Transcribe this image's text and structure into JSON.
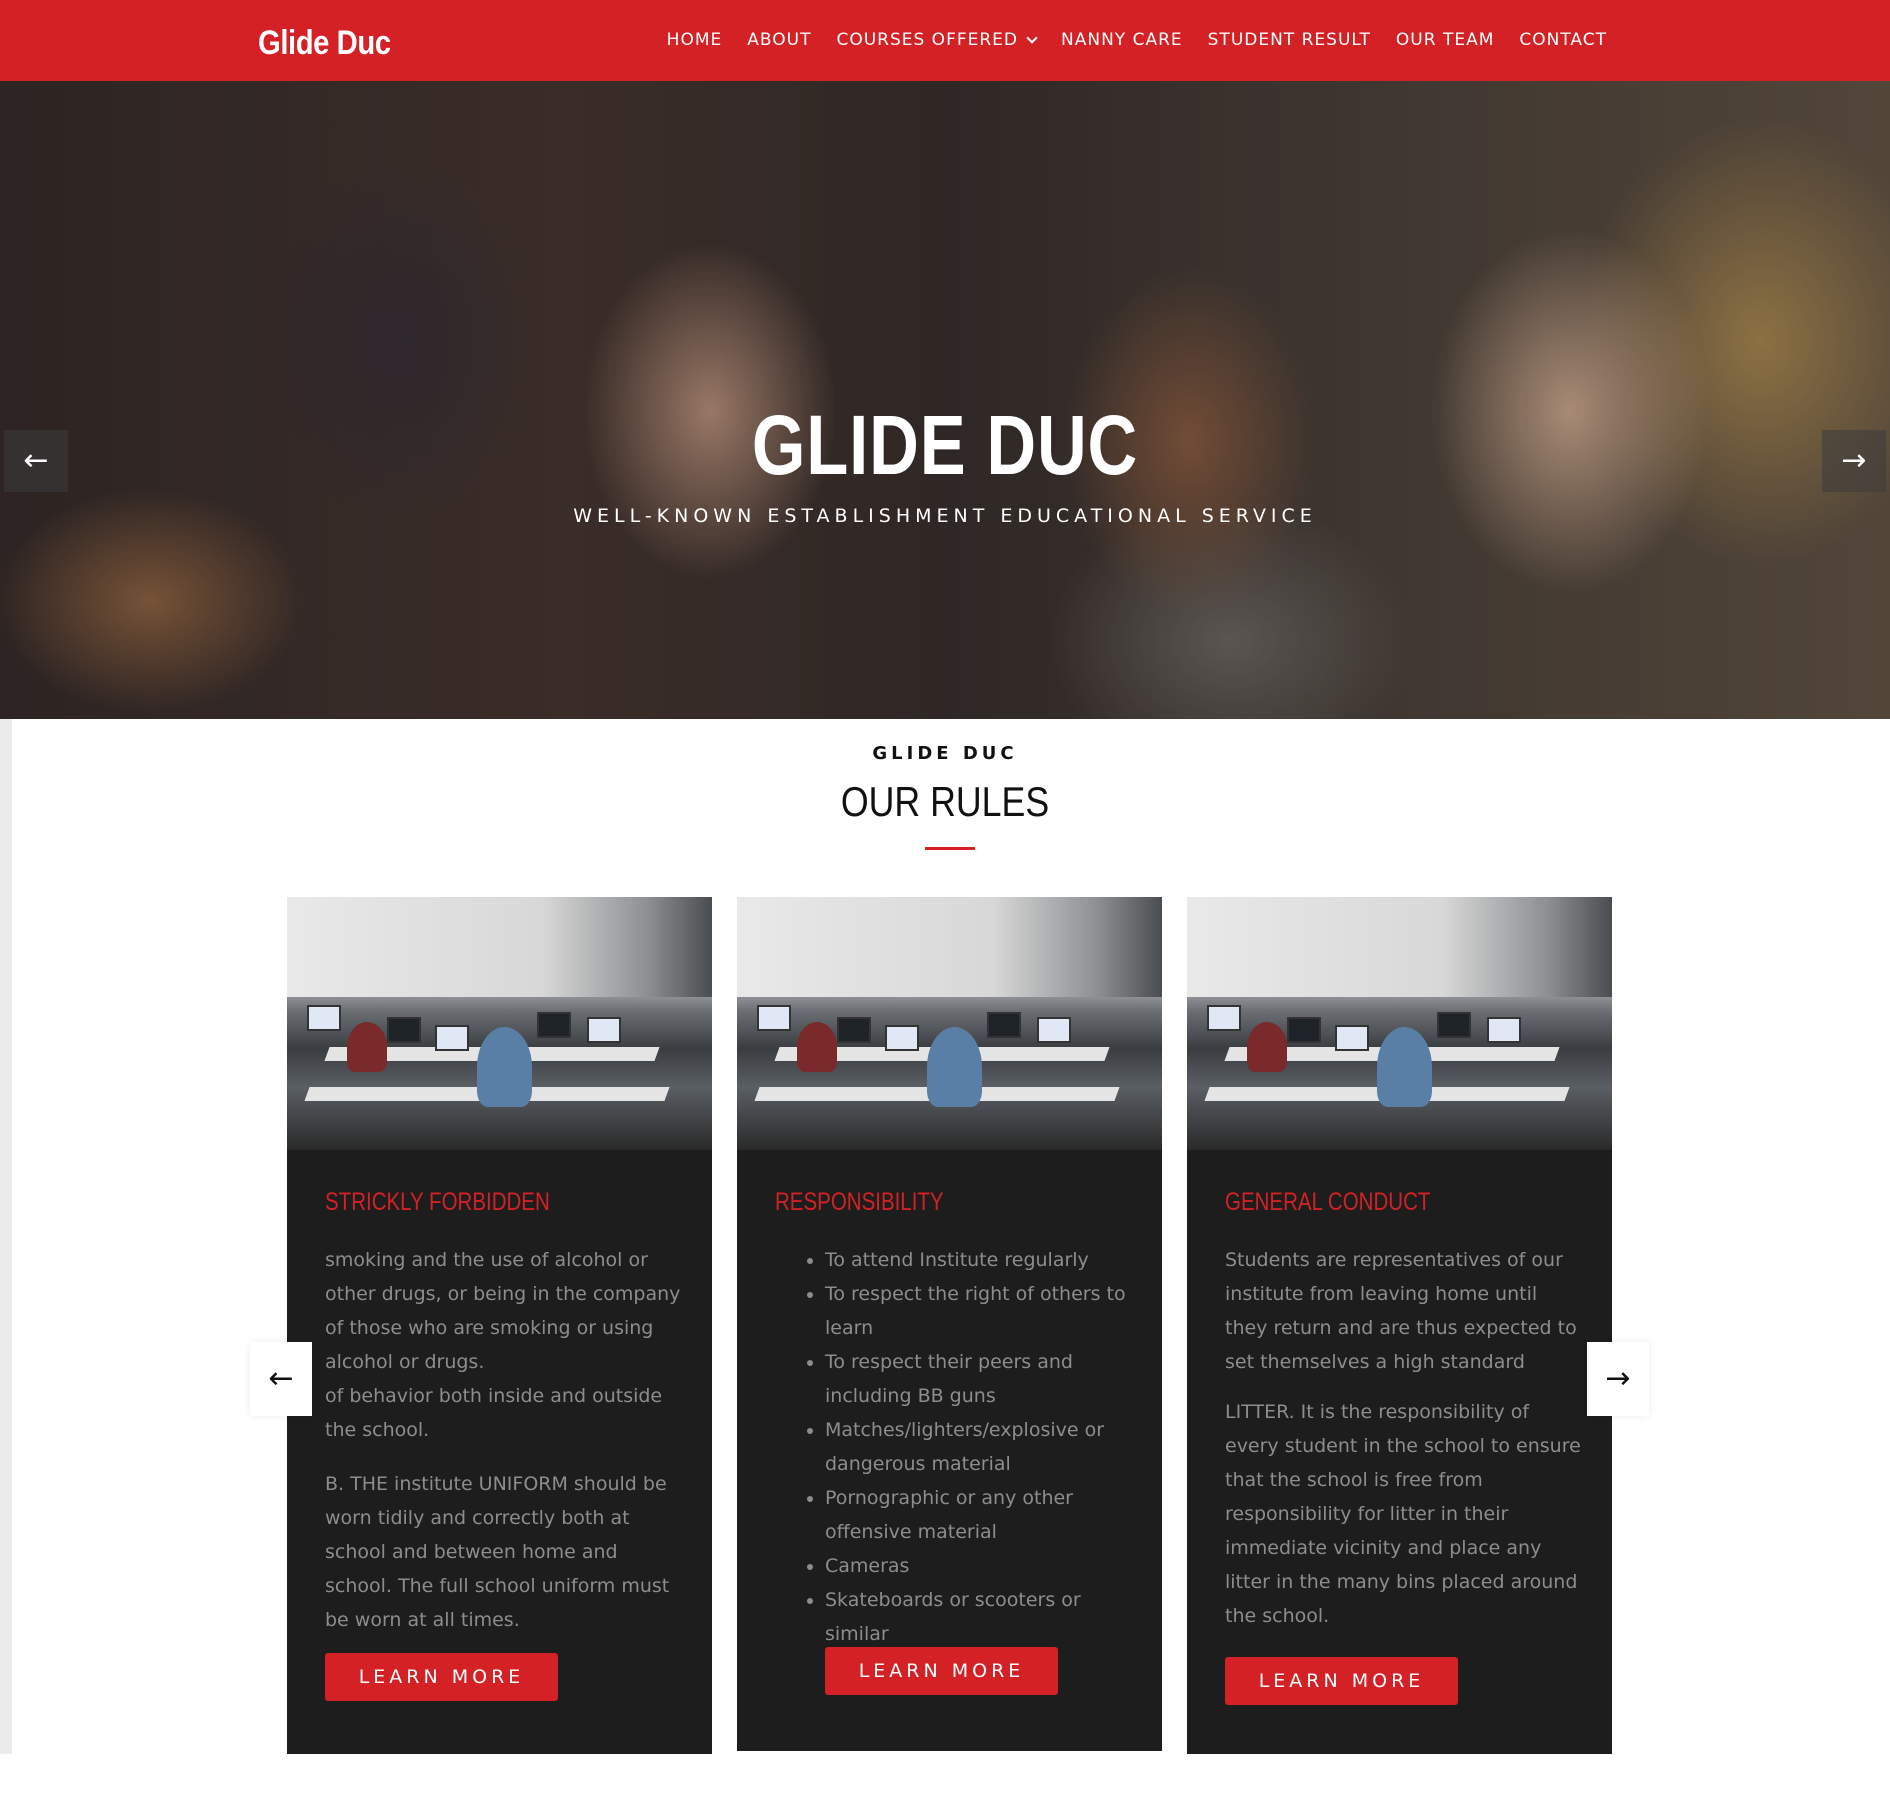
{
  "nav": {
    "brand": "Glide Duc",
    "items": [
      {
        "label": "HOME"
      },
      {
        "label": "ABOUT"
      },
      {
        "label": "COURSES OFFERED"
      },
      {
        "label": "NANNY CARE"
      },
      {
        "label": "STUDENT RESULT"
      },
      {
        "label": "OUR TEAM"
      },
      {
        "label": "CONTACT"
      }
    ]
  },
  "hero": {
    "title": "GLIDE DUC",
    "subtitle": "WELL-KNOWN ESTABLISHMENT EDUCATIONAL SERVICE",
    "prev_icon": "←",
    "next_icon": "→"
  },
  "section": {
    "eyebrow": "GLIDE DUC",
    "title": "OUR RULES"
  },
  "cards": [
    {
      "heading": "STRICKLY FORBIDDEN",
      "paragraphs": [
        "smoking and the use of alcohol or other drugs, or being in the company of those who are smoking or using alcohol or drugs.",
        "of behavior both inside and outside the school.",
        "B. THE institute UNIFORM should be worn tidily and correctly both at school and between home and school. The full school uniform must be worn at all times."
      ],
      "button": "LEARN MORE"
    },
    {
      "heading": "RESPONSIBILITY",
      "bullets": [
        "To attend Institute regularly",
        "To respect the right of others to learn",
        "To respect their peers and including BB guns",
        "Matches/lighters/explosive or dangerous material",
        "Pornographic or any other offensive material",
        "Cameras",
        "Skateboards or scooters or similar"
      ],
      "button": "LEARN MORE"
    },
    {
      "heading": "GENERAL CONDUCT",
      "paragraphs": [
        "Students are representatives of our institute from leaving home until they return and are thus expected to set themselves a high standard",
        "LITTER. It is the responsibility of every student in the school to ensure that the school is free from responsibility for litter in their immediate vicinity and place any litter in the many bins placed around the school."
      ],
      "button": "LEARN MORE"
    }
  ],
  "slider": {
    "prev_icon": "←",
    "next_icon": "→"
  },
  "colors": {
    "brand_red": "#d32126",
    "card_bg": "#1d1d1d",
    "card_text": "#8d8d8d"
  }
}
